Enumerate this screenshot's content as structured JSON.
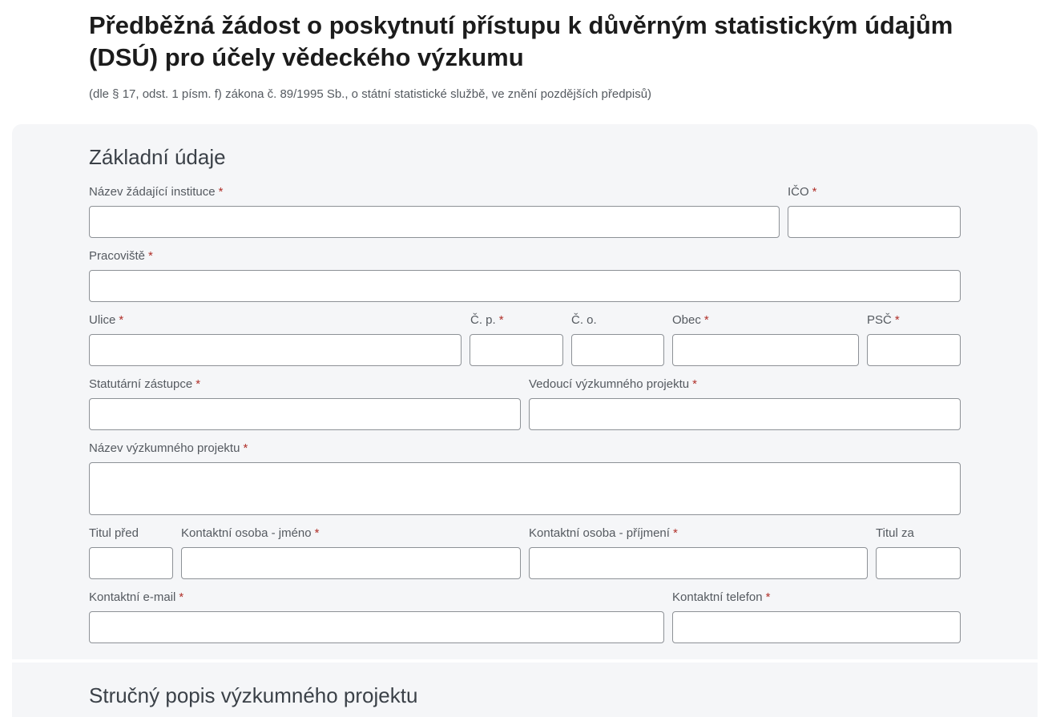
{
  "header": {
    "title": "Předběžná žádost o poskytnutí přístupu k důvěrným statistickým údajům (DSÚ) pro účely vědeckého výzkumu",
    "subtitle": "(dle § 17, odst. 1 písm. f) zákona č. 89/1995 Sb., o státní statistické službě, ve znění pozdějších předpisů)"
  },
  "required_marker": "*",
  "colors": {
    "section_background": "#f5f6f8",
    "required_marker": "#b0302a",
    "input_border": "#8d9196"
  },
  "section_basic": {
    "title": "Základní údaje",
    "fields": {
      "institution_name": {
        "label": "Název žádající instituce",
        "value": ""
      },
      "ico": {
        "label": "IČO",
        "value": ""
      },
      "workplace": {
        "label": "Pracoviště",
        "value": ""
      },
      "street": {
        "label": "Ulice",
        "value": ""
      },
      "house_number": {
        "label": "Č. p.",
        "value": ""
      },
      "orientation_number": {
        "label": "Č. o.",
        "value": ""
      },
      "city": {
        "label": "Obec",
        "value": ""
      },
      "postal_code": {
        "label": "PSČ",
        "value": ""
      },
      "statutory_rep": {
        "label": "Statutární zástupce",
        "value": ""
      },
      "project_lead": {
        "label": "Vedoucí výzkumného projektu",
        "value": ""
      },
      "project_name": {
        "label": "Název výzkumného projektu",
        "value": ""
      },
      "title_before": {
        "label": "Titul před",
        "value": ""
      },
      "contact_first_name": {
        "label": "Kontaktní osoba - jméno",
        "value": ""
      },
      "contact_last_name": {
        "label": "Kontaktní osoba - příjmení",
        "value": ""
      },
      "title_after": {
        "label": "Titul za",
        "value": ""
      },
      "contact_email": {
        "label": "Kontaktní e-mail",
        "value": ""
      },
      "contact_phone": {
        "label": "Kontaktní telefon",
        "value": ""
      }
    }
  },
  "section_description": {
    "title": "Stručný popis výzkumného projektu"
  }
}
